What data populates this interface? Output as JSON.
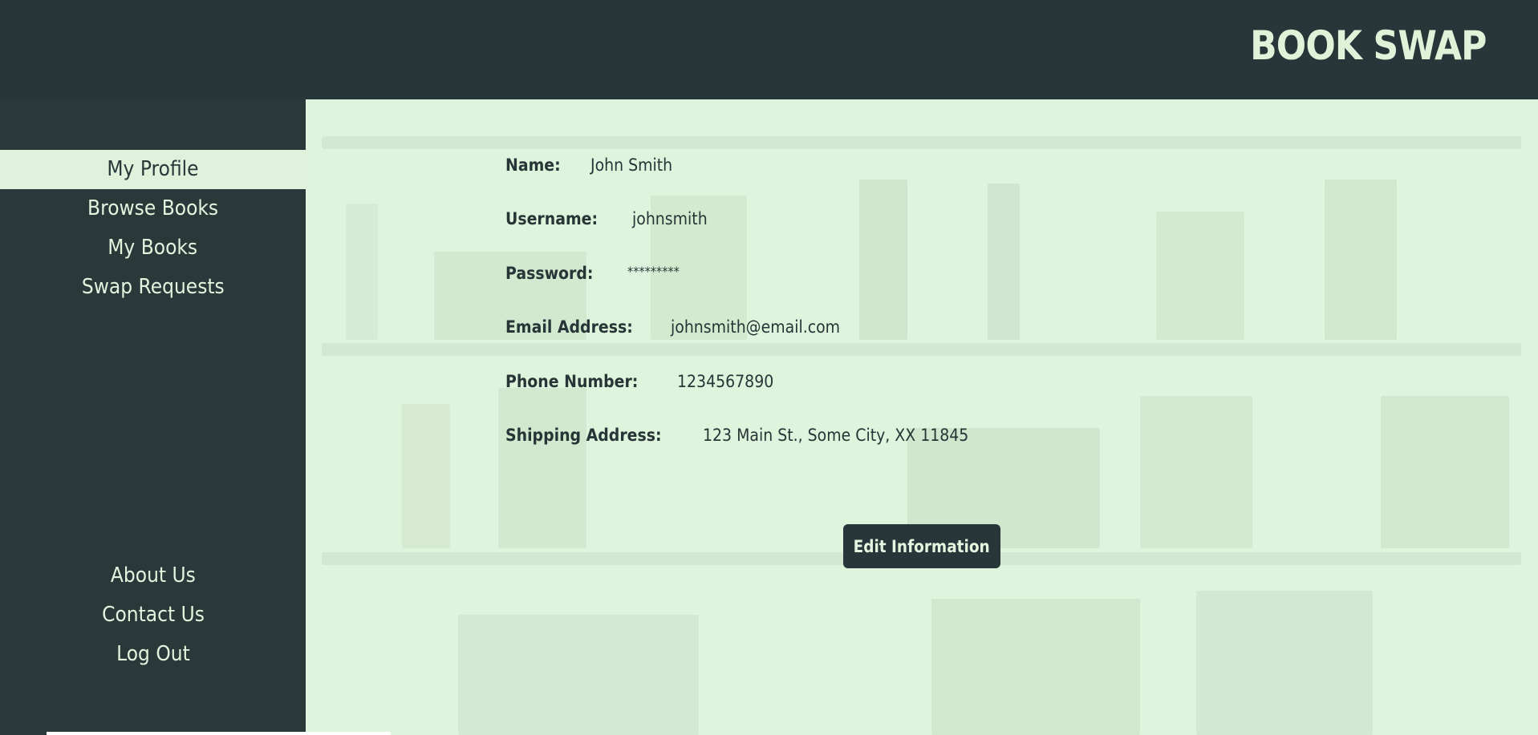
{
  "header": {
    "brand": "BOOK SWAP"
  },
  "sidebar": {
    "nav_top": [
      "My Profile",
      "Browse Books",
      "My Books",
      "Swap Requests"
    ],
    "nav_bottom": [
      "About Us",
      "Contact Us",
      "Log Out"
    ]
  },
  "profile": {
    "name_label": "Name:",
    "name_value": "John Smith",
    "username_label": "Username:",
    "username_value": "johnsmith",
    "password_label": "Password:",
    "password_value": "*********",
    "email_label": "Email Address:",
    "email_value": "johnsmith@email.com",
    "phone_label": "Phone Number:",
    "phone_value": "1234567890",
    "address_label": "Shipping Address:",
    "address_value": "123 Main St., Some City, XX 11845"
  },
  "actions": {
    "edit_label": "Edit Information"
  },
  "colors": {
    "header_bg": "#273639",
    "sidebar_bg": "#293939",
    "content_bg": "#dff4dc",
    "accent_text": "#dff3d9"
  }
}
